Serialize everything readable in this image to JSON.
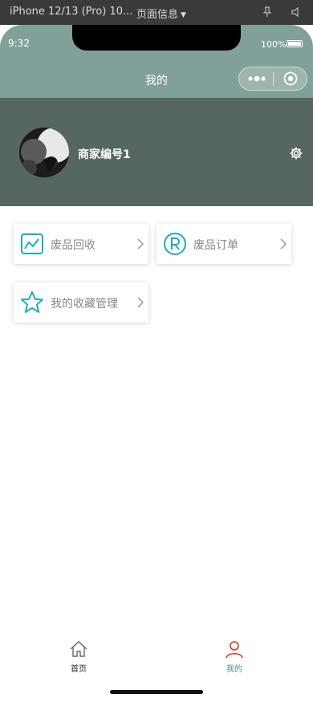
{
  "devtools": {
    "device_label": "iPhone 12/13 (Pro) 10...",
    "page_info_label": "页面信息"
  },
  "status_bar": {
    "time": "9:32",
    "battery": "100%"
  },
  "nav": {
    "title": "我的"
  },
  "profile": {
    "merchant_name": "商家编号1"
  },
  "menu": {
    "items": [
      {
        "label": "废品回收",
        "icon": "chart-line-icon"
      },
      {
        "label": "废品订单",
        "icon": "registered-r-icon"
      },
      {
        "label": "我的收藏管理",
        "icon": "star-icon"
      }
    ]
  },
  "tabbar": {
    "items": [
      {
        "label": "首页",
        "icon": "home-icon",
        "active": false
      },
      {
        "label": "我的",
        "icon": "user-icon",
        "active": true
      }
    ]
  },
  "colors": {
    "header_bar": "#81a099",
    "profile_bg": "#566660",
    "icon_teal": "#1aaeb8",
    "tab_active_icon": "#d23b2a",
    "tab_active_label": "#5a8f86"
  }
}
